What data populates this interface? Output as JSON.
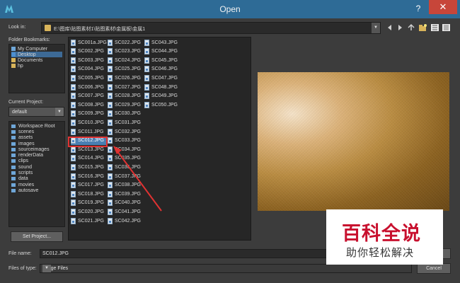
{
  "window": {
    "title": "Open",
    "help": "?",
    "close": "✕"
  },
  "look_in": {
    "label": "Look in:",
    "path": "E:\\图库\\贴图素材1\\贴图素材\\金属板\\金属1"
  },
  "bookmarks": {
    "label": "Folder Bookmarks:",
    "items": [
      "My Computer",
      "Desktop",
      "Documents",
      "hp"
    ]
  },
  "project": {
    "label": "Current Project:",
    "selected": "default",
    "items": [
      "Workspace Root",
      "scenes",
      "assets",
      "images",
      "sourceimages",
      "renderData",
      "clips",
      "sound",
      "scripts",
      "data",
      "movies",
      "autosave"
    ],
    "set_button": "Set Project..."
  },
  "files": {
    "col1": [
      "SC001a.JPG",
      "SC002.JPG",
      "SC003.JPG",
      "SC004.JPG",
      "SC005.JPG",
      "SC006.JPG",
      "SC007.JPG",
      "SC008.JPG",
      "SC009.JPG",
      "SC010.JPG",
      "SC011.JPG",
      "SC012.JPG",
      "SC013.JPG",
      "SC014.JPG",
      "SC015.JPG",
      "SC016.JPG",
      "SC017.JPG",
      "SC018.JPG",
      "SC019.JPG",
      "SC020.JPG",
      "SC021.JPG"
    ],
    "col2": [
      "SC022.JPG",
      "SC023.JPG",
      "SC024.JPG",
      "SC025.JPG",
      "SC026.JPG",
      "SC027.JPG",
      "SC028.JPG",
      "SC029.JPG",
      "SC030.JPG",
      "SC031.JPG",
      "SC032.JPG",
      "SC033.JPG",
      "SC034.JPG",
      "SC035.JPG",
      "SC036.JPG",
      "SC037.JPG",
      "SC038.JPG",
      "SC039.JPG",
      "SC040.JPG",
      "SC041.JPG",
      "SC042.JPG"
    ],
    "col3": [
      "SC043.JPG",
      "SC044.JPG",
      "SC045.JPG",
      "SC046.JPG",
      "SC047.JPG",
      "SC048.JPG",
      "SC049.JPG",
      "SC050.JPG"
    ],
    "selected": "SC012.JPG"
  },
  "file_name": {
    "label": "File name:",
    "value": "SC012.JPG"
  },
  "file_type": {
    "label": "Files of type:",
    "value": "Image Files"
  },
  "buttons": {
    "cancel": "Cancel"
  },
  "watermark": {
    "logo": "百科全说",
    "sub": "助你轻松解决"
  },
  "colors": {
    "titlebar": "#2e6b96",
    "close": "#c7463a",
    "selection": "#4a7fb2",
    "highlight": "#e03232",
    "watermark": "#c8102e"
  }
}
